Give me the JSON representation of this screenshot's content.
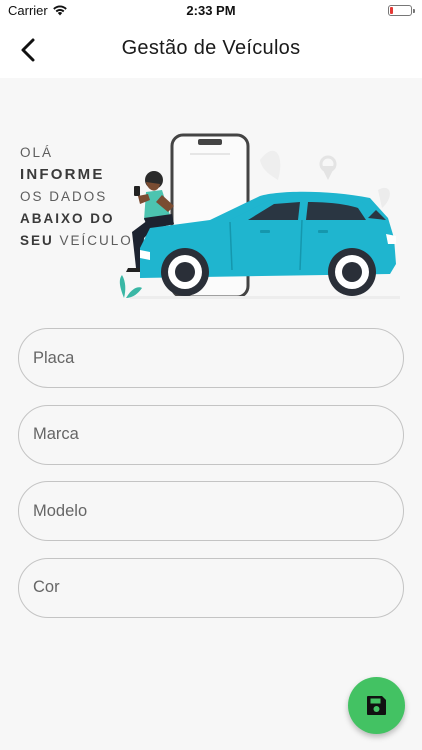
{
  "status_bar": {
    "carrier": "Carrier",
    "time": "2:33 PM",
    "icons": [
      "wifi-icon",
      "battery-icon"
    ],
    "battery_color": "#e53935"
  },
  "nav": {
    "title": "Gestão de Veículos",
    "back_icon": "chevron-left-icon"
  },
  "hero": {
    "line1": "OLÁ",
    "line2": "INFORME",
    "line3": "OS DADOS",
    "line4": "ABAIXO DO",
    "line5_bold": "SEU",
    "line5_rest": " VEÍCULO",
    "illustration": "person-leaning-on-car-with-phone",
    "car_color": "#1fb5cf"
  },
  "form": {
    "placa_placeholder": "Placa",
    "marca_placeholder": "Marca",
    "modelo_placeholder": "Modelo",
    "cor_placeholder": "Cor"
  },
  "fab": {
    "icon": "save-icon",
    "color": "#43c263"
  }
}
